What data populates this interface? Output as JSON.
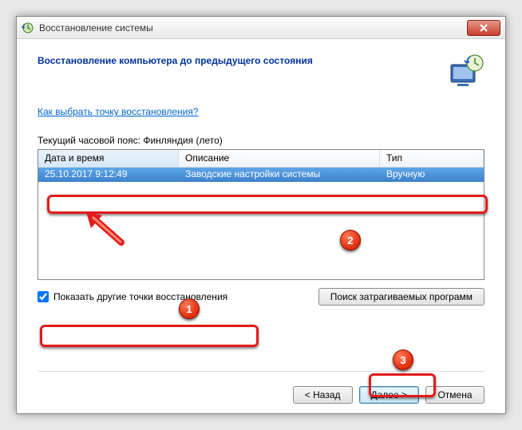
{
  "window": {
    "title": "Восстановление системы"
  },
  "header": {
    "heading": "Восстановление компьютера до предыдущего состояния"
  },
  "link": {
    "choose_point": "Как выбрать точку восстановления?"
  },
  "timezone": {
    "label": "Текущий часовой пояс: Финляндия (лето)"
  },
  "table": {
    "columns": {
      "datetime": "Дата и время",
      "description": "Описание",
      "type": "Тип"
    },
    "rows": [
      {
        "datetime": "25.10.2017 9:12:49",
        "description": "Заводские настройки системы",
        "type": "Вручную"
      }
    ]
  },
  "checkbox": {
    "show_other": "Показать другие точки восстановления",
    "checked": true
  },
  "buttons": {
    "affected": "Поиск затрагиваемых программ",
    "back": "< Назад",
    "next": "Далее >",
    "cancel": "Отмена"
  },
  "annotations": {
    "b1": "1",
    "b2": "2",
    "b3": "3"
  }
}
